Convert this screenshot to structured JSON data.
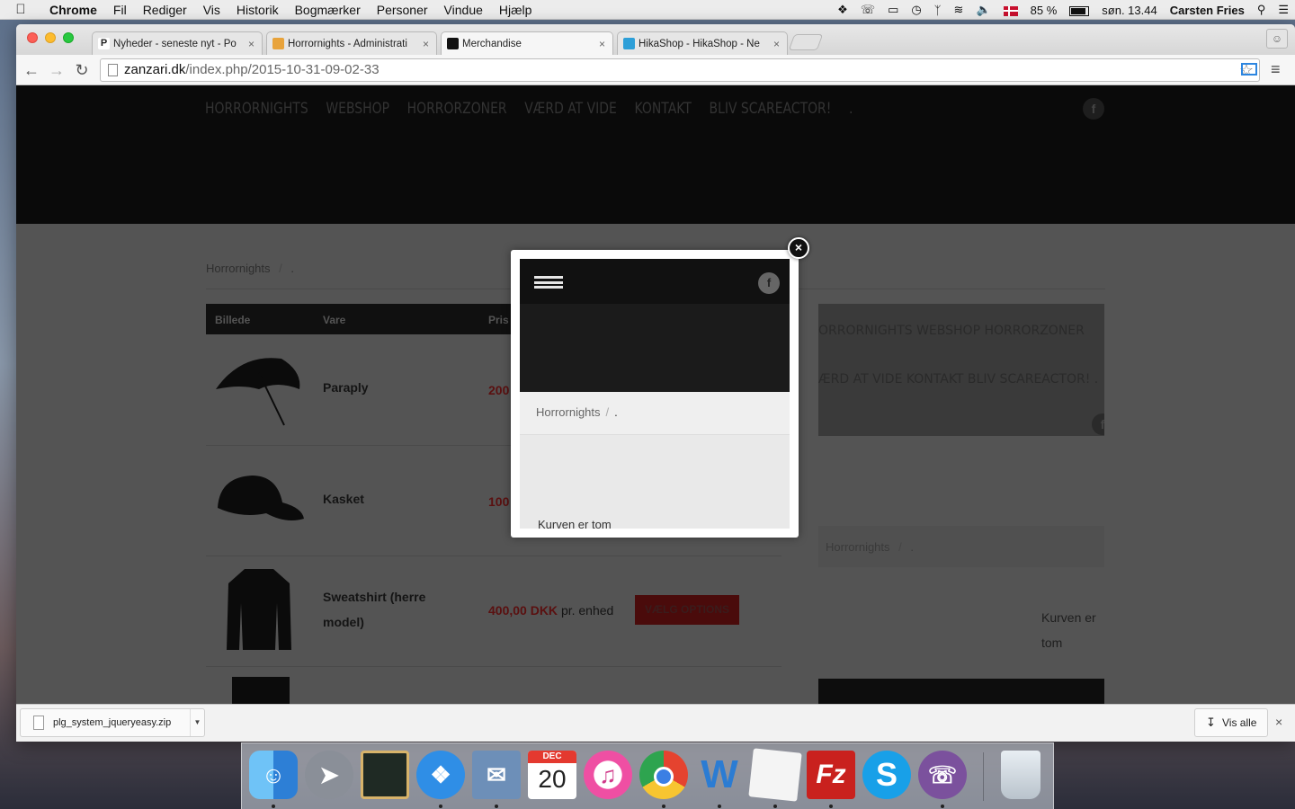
{
  "menubar": {
    "app": "Chrome",
    "items": [
      "Fil",
      "Rediger",
      "Vis",
      "Historik",
      "Bogmærker",
      "Personer",
      "Vindue",
      "Hjælp"
    ],
    "battery": "85 %",
    "clock": "søn. 13.44",
    "user": "Carsten Fries"
  },
  "tabs": [
    {
      "title": "Nyheder - seneste nyt - Po",
      "favicon_color": "#ffffff",
      "favicon_letter": "P"
    },
    {
      "title": "Horrornights - Administrati",
      "favicon_color": "#e8a33b"
    },
    {
      "title": "Merchandise",
      "favicon_color": "#111111",
      "active": true
    },
    {
      "title": "HikaShop - HikaShop - Ne",
      "favicon_color": "#2d9fd8"
    }
  ],
  "address": {
    "domain": "zanzari.dk",
    "path": "/index.php/2015-10-31-09-02-33"
  },
  "site": {
    "nav": [
      "HORRORNIGHTS",
      "WEBSHOP",
      "HORRORZONER",
      "VÆRD AT VIDE",
      "KONTAKT",
      "BLIV SCAREACTOR!",
      "."
    ],
    "breadcrumb_home": "Horrornights",
    "breadcrumb_sep": "/",
    "breadcrumb_current": ".",
    "table_headers": {
      "image": "Billede",
      "item": "Vare",
      "price": "Pris"
    },
    "products": [
      {
        "name": "Paraply",
        "price": "200"
      },
      {
        "name": "Kasket",
        "price": "100"
      },
      {
        "name": "Sweatshirt (herre model)",
        "name_line1": "Sweatshirt (herre",
        "name_line2": "model)",
        "price": "400,00 DKK",
        "unit": "pr. enhed"
      }
    ],
    "options_button": "VÆLG OPTIONS",
    "side_menu_line1": "ORRORNIGHTS WEBSHOP HORRORZONER",
    "side_menu_line2": "ÆRD AT VIDE KONTAKT BLIV SCAREACTOR! .",
    "cart_line1": "Kurven er",
    "cart_line2": "tom"
  },
  "modal": {
    "breadcrumb_home": "Horrornights",
    "breadcrumb_sep": "/",
    "breadcrumb_current": ".",
    "cart_text": "Kurven er tom",
    "close_symbol": "×"
  },
  "downloads": {
    "file": "plg_system_jqueryeasy.zip",
    "show_all": "Vis alle"
  },
  "dock": {
    "calendar_month": "DEC",
    "calendar_day": "20",
    "apps": [
      {
        "name": "finder",
        "color": "#3b8fe0"
      },
      {
        "name": "launchpad",
        "color": "#7a7f88"
      },
      {
        "name": "photo-app",
        "color": "#2a2a2a"
      },
      {
        "name": "safari",
        "color": "#2f8ee6"
      },
      {
        "name": "mail",
        "color": "#6d8fb8"
      },
      {
        "name": "calendar",
        "color": "#ffffff"
      },
      {
        "name": "itunes",
        "color": "#ef4fa3"
      },
      {
        "name": "chrome",
        "color": "#e5432f"
      },
      {
        "name": "word",
        "color": "#2b7cd3"
      },
      {
        "name": "textedit",
        "color": "#efefef"
      },
      {
        "name": "filezilla",
        "color": "#c9211e"
      },
      {
        "name": "skype",
        "color": "#18a0e8"
      },
      {
        "name": "viber",
        "color": "#7b519d"
      }
    ]
  }
}
